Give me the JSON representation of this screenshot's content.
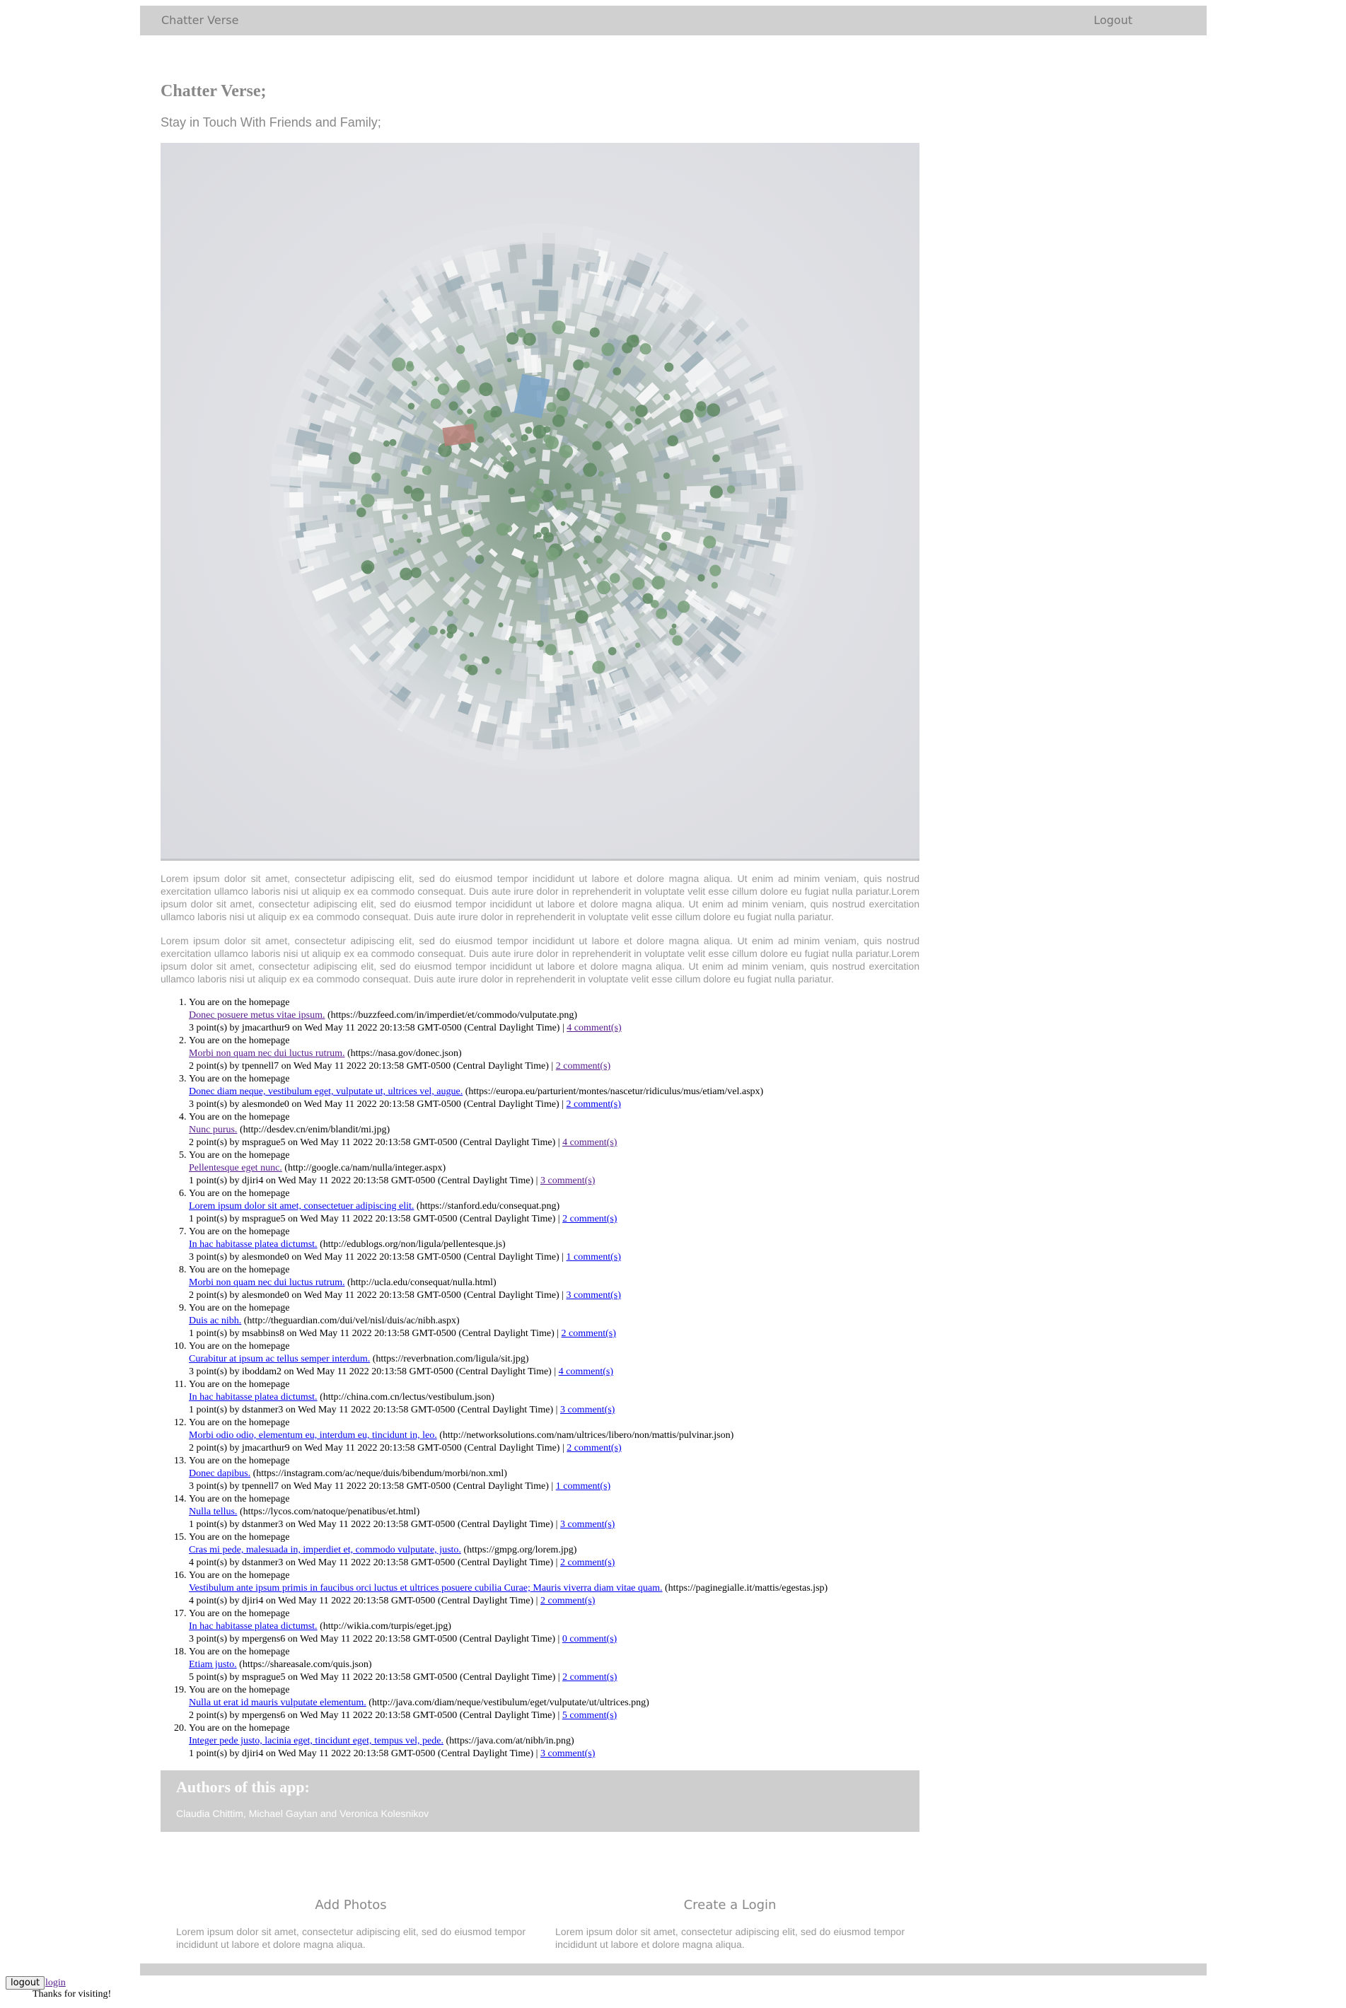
{
  "nav": {
    "brand": "Chatter Verse",
    "logout": "Logout"
  },
  "header": {
    "title": "Chatter Verse;",
    "tagline": "Stay in Touch With Friends and Family;"
  },
  "hero": {
    "alt": "aerial photo of a city bent into a little planet"
  },
  "paragraphs": [
    "Lorem ipsum dolor sit amet, consectetur adipiscing elit, sed do eiusmod tempor incididunt ut labore et dolore magna aliqua. Ut enim ad minim veniam, quis nostrud exercitation ullamco laboris nisi ut aliquip ex ea commodo consequat. Duis aute irure dolor in reprehenderit in voluptate velit esse cillum dolore eu fugiat nulla pariatur.Lorem ipsum dolor sit amet, consectetur adipiscing elit, sed do eiusmod tempor incididunt ut labore et dolore magna aliqua. Ut enim ad minim veniam, quis nostrud exercitation ullamco laboris nisi ut aliquip ex ea commodo consequat. Duis aute irure dolor in reprehenderit in voluptate velit esse cillum dolore eu fugiat nulla pariatur.",
    "Lorem ipsum dolor sit amet, consectetur adipiscing elit, sed do eiusmod tempor incididunt ut labore et dolore magna aliqua. Ut enim ad minim veniam, quis nostrud exercitation ullamco laboris nisi ut aliquip ex ea commodo consequat. Duis aute irure dolor in reprehenderit in voluptate velit esse cillum dolore eu fugiat nulla pariatur.Lorem ipsum dolor sit amet, consectetur adipiscing elit, sed do eiusmod tempor incididunt ut labore et dolore magna aliqua. Ut enim ad minim veniam, quis nostrud exercitation ullamco laboris nisi ut aliquip ex ea commodo consequat. Duis aute irure dolor in reprehenderit in voluptate velit esse cillum dolore eu fugiat nulla pariatur."
  ],
  "posts": [
    {
      "context": "You are on the homepage",
      "title": "Donec posuere metus vitae ipsum.",
      "url": "(https://buzzfeed.com/in/imperdiet/et/commodo/vulputate.png)",
      "meta": "3 point(s) by jmacarthur9 on Wed May 11 2022 20:13:58 GMT-0500 (Central Daylight Time) |",
      "comments": "4 comment(s)",
      "title_visited": true,
      "comments_visited": true
    },
    {
      "context": "You are on the homepage",
      "title": "Morbi non quam nec dui luctus rutrum.",
      "url": "(https://nasa.gov/donec.json)",
      "meta": "2 point(s) by tpennell7 on Wed May 11 2022 20:13:58 GMT-0500 (Central Daylight Time) |",
      "comments": "2 comment(s)",
      "title_visited": true,
      "comments_visited": true
    },
    {
      "context": "You are on the homepage",
      "title": "Donec diam neque, vestibulum eget, vulputate ut, ultrices vel, augue.",
      "url": "(https://europa.eu/parturient/montes/nascetur/ridiculus/mus/etiam/vel.aspx)",
      "meta": "3 point(s) by alesmonde0 on Wed May 11 2022 20:13:58 GMT-0500 (Central Daylight Time) |",
      "comments": "2 comment(s)",
      "title_visited": false,
      "comments_visited": false
    },
    {
      "context": "You are on the homepage",
      "title": "Nunc purus.",
      "url": "(http://desdev.cn/enim/blandit/mi.jpg)",
      "meta": "2 point(s) by msprague5 on Wed May 11 2022 20:13:58 GMT-0500 (Central Daylight Time) |",
      "comments": "4 comment(s)",
      "title_visited": true,
      "comments_visited": true
    },
    {
      "context": "You are on the homepage",
      "title": "Pellentesque eget nunc.",
      "url": "(http://google.ca/nam/nulla/integer.aspx)",
      "meta": "1 point(s) by djiri4 on Wed May 11 2022 20:13:58 GMT-0500 (Central Daylight Time) |",
      "comments": "3 comment(s)",
      "title_visited": true,
      "comments_visited": true
    },
    {
      "context": "You are on the homepage",
      "title": "Lorem ipsum dolor sit amet, consectetuer adipiscing elit.",
      "url": "(https://stanford.edu/consequat.png)",
      "meta": "1 point(s) by msprague5 on Wed May 11 2022 20:13:58 GMT-0500 (Central Daylight Time) |",
      "comments": "2 comment(s)",
      "title_visited": false,
      "comments_visited": false
    },
    {
      "context": "You are on the homepage",
      "title": "In hac habitasse platea dictumst.",
      "url": "(http://edublogs.org/non/ligula/pellentesque.js)",
      "meta": "3 point(s) by alesmonde0 on Wed May 11 2022 20:13:58 GMT-0500 (Central Daylight Time) |",
      "comments": "1 comment(s)",
      "title_visited": false,
      "comments_visited": false
    },
    {
      "context": "You are on the homepage",
      "title": "Morbi non quam nec dui luctus rutrum.",
      "url": "(http://ucla.edu/consequat/nulla.html)",
      "meta": "2 point(s) by alesmonde0 on Wed May 11 2022 20:13:58 GMT-0500 (Central Daylight Time) |",
      "comments": "3 comment(s)",
      "title_visited": false,
      "comments_visited": false
    },
    {
      "context": "You are on the homepage",
      "title": "Duis ac nibh.",
      "url": "(http://theguardian.com/dui/vel/nisl/duis/ac/nibh.aspx)",
      "meta": "1 point(s) by msabbins8 on Wed May 11 2022 20:13:58 GMT-0500 (Central Daylight Time) |",
      "comments": "2 comment(s)",
      "title_visited": false,
      "comments_visited": false
    },
    {
      "context": "You are on the homepage",
      "title": "Curabitur at ipsum ac tellus semper interdum.",
      "url": "(https://reverbnation.com/ligula/sit.jpg)",
      "meta": "3 point(s) by iboddam2 on Wed May 11 2022 20:13:58 GMT-0500 (Central Daylight Time) |",
      "comments": "4 comment(s)",
      "title_visited": false,
      "comments_visited": false
    },
    {
      "context": "You are on the homepage",
      "title": "In hac habitasse platea dictumst.",
      "url": "(http://china.com.cn/lectus/vestibulum.json)",
      "meta": "1 point(s) by dstanmer3 on Wed May 11 2022 20:13:58 GMT-0500 (Central Daylight Time) |",
      "comments": "3 comment(s)",
      "title_visited": false,
      "comments_visited": false
    },
    {
      "context": "You are on the homepage",
      "title": "Morbi odio odio, elementum eu, interdum eu, tincidunt in, leo.",
      "url": "(http://networksolutions.com/nam/ultrices/libero/non/mattis/pulvinar.json)",
      "meta": "2 point(s) by jmacarthur9 on Wed May 11 2022 20:13:58 GMT-0500 (Central Daylight Time) |",
      "comments": "2 comment(s)",
      "title_visited": false,
      "comments_visited": false
    },
    {
      "context": "You are on the homepage",
      "title": "Donec dapibus.",
      "url": "(https://instagram.com/ac/neque/duis/bibendum/morbi/non.xml)",
      "meta": "3 point(s) by tpennell7 on Wed May 11 2022 20:13:58 GMT-0500 (Central Daylight Time) |",
      "comments": "1 comment(s)",
      "title_visited": false,
      "comments_visited": false
    },
    {
      "context": "You are on the homepage",
      "title": "Nulla tellus.",
      "url": "(https://lycos.com/natoque/penatibus/et.html)",
      "meta": "1 point(s) by dstanmer3 on Wed May 11 2022 20:13:58 GMT-0500 (Central Daylight Time) |",
      "comments": "3 comment(s)",
      "title_visited": false,
      "comments_visited": false
    },
    {
      "context": "You are on the homepage",
      "title": "Cras mi pede, malesuada in, imperdiet et, commodo vulputate, justo.",
      "url": "(https://gmpg.org/lorem.jpg)",
      "meta": "4 point(s) by dstanmer3 on Wed May 11 2022 20:13:58 GMT-0500 (Central Daylight Time) |",
      "comments": "2 comment(s)",
      "title_visited": false,
      "comments_visited": false
    },
    {
      "context": "You are on the homepage",
      "title": "Vestibulum ante ipsum primis in faucibus orci luctus et ultrices posuere cubilia Curae; Mauris viverra diam vitae quam.",
      "url": "(https://paginegialle.it/mattis/egestas.jsp)",
      "meta": "4 point(s) by djiri4 on Wed May 11 2022 20:13:58 GMT-0500 (Central Daylight Time) |",
      "comments": "2 comment(s)",
      "title_visited": false,
      "comments_visited": false
    },
    {
      "context": "You are on the homepage",
      "title": "In hac habitasse platea dictumst.",
      "url": "(http://wikia.com/turpis/eget.jpg)",
      "meta": "3 point(s) by mpergens6 on Wed May 11 2022 20:13:58 GMT-0500 (Central Daylight Time) |",
      "comments": "0 comment(s)",
      "title_visited": false,
      "comments_visited": false
    },
    {
      "context": "You are on the homepage",
      "title": "Etiam justo.",
      "url": "(https://shareasale.com/quis.json)",
      "meta": "5 point(s) by msprague5 on Wed May 11 2022 20:13:58 GMT-0500 (Central Daylight Time) |",
      "comments": "2 comment(s)",
      "title_visited": false,
      "comments_visited": false
    },
    {
      "context": "You are on the homepage",
      "title": "Nulla ut erat id mauris vulputate elementum.",
      "url": "(http://java.com/diam/neque/vestibulum/eget/vulputate/ut/ultrices.png)",
      "meta": "2 point(s) by mpergens6 on Wed May 11 2022 20:13:58 GMT-0500 (Central Daylight Time) |",
      "comments": "5 comment(s)",
      "title_visited": false,
      "comments_visited": false
    },
    {
      "context": "You are on the homepage",
      "title": "Integer pede justo, lacinia eget, tincidunt eget, tempus vel, pede.",
      "url": "(https://java.com/at/nibh/in.png)",
      "meta": "1 point(s) by djiri4 on Wed May 11 2022 20:13:58 GMT-0500 (Central Daylight Time) |",
      "comments": "3 comment(s)",
      "title_visited": false,
      "comments_visited": false
    }
  ],
  "authors": {
    "heading": "Authors of this app:",
    "names": "Claudia Chittim, Michael Gaytan and Veronica Kolesnikov"
  },
  "features": [
    {
      "title": "Add Photos",
      "text": "Lorem ipsum dolor sit amet, consectetur adipiscing elit, sed do eiusmod tempor incididunt ut labore et dolore magna aliqua."
    },
    {
      "title": "Create a Login",
      "text": "Lorem ipsum dolor sit amet, consectetur adipiscing elit, sed do eiusmod tempor incididunt ut labore et dolore magna aliqua."
    }
  ],
  "bottom": {
    "logout_button": "logout",
    "login_link": "login",
    "thanks": "Thanks for visiting!"
  },
  "colors": {
    "bar": "#d0d0d0",
    "muted_text": "#888888",
    "link": "#0000ee",
    "visited_link": "#551a8b",
    "authors_bg": "#cecece"
  }
}
